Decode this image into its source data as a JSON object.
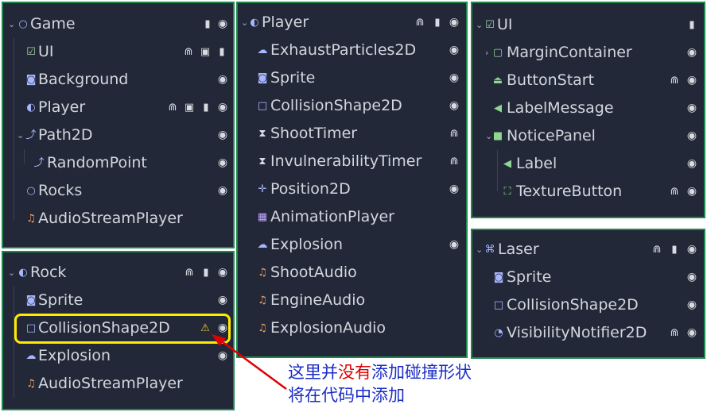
{
  "colors": {
    "panel_bg": "#222838",
    "frame": "#1f8a4d",
    "highlight": "#ffea00",
    "note_text": "#1a2cc8",
    "note_emph": "#e00000"
  },
  "panels": {
    "game": {
      "root": "Game",
      "items": [
        "UI",
        "Background",
        "Player",
        "Path2D",
        "RandomPoint",
        "Rocks",
        "AudioStreamPlayer"
      ]
    },
    "player": {
      "root": "Player",
      "items": [
        "ExhaustParticles2D",
        "Sprite",
        "CollisionShape2D",
        "ShootTimer",
        "InvulnerabilityTimer",
        "Position2D",
        "AnimationPlayer",
        "Explosion",
        "ShootAudio",
        "EngineAudio",
        "ExplosionAudio"
      ]
    },
    "ui": {
      "root": "UI",
      "items": [
        "MarginContainer",
        "ButtonStart",
        "LabelMessage",
        "NoticePanel",
        "Label",
        "TextureButton"
      ]
    },
    "rock": {
      "root": "Rock",
      "items": [
        "Sprite",
        "CollisionShape2D",
        "Explosion",
        "AudioStreamPlayer"
      ]
    },
    "laser": {
      "root": "Laser",
      "items": [
        "Sprite",
        "CollisionShape2D",
        "VisibilityNotifier2D"
      ]
    }
  },
  "annotation": {
    "line1_a": "这里并",
    "line1_b": "没有",
    "line1_c": "添加碰撞形状",
    "line2": "将在代码中添加"
  }
}
